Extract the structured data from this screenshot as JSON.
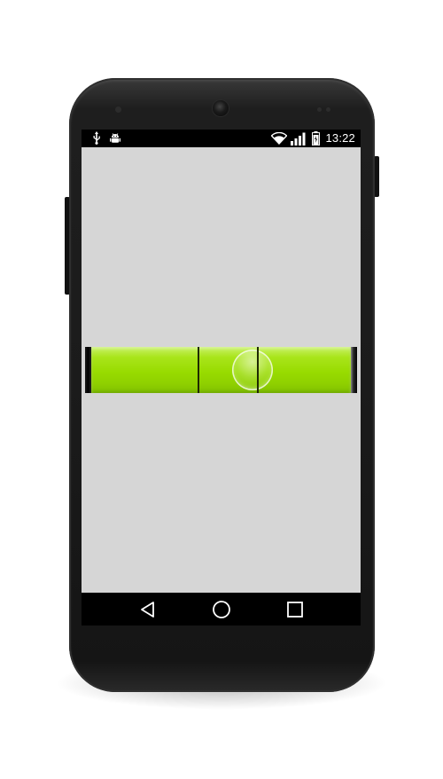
{
  "status_bar": {
    "time": "13:22",
    "icons": [
      "usb-icon",
      "android-debug-icon",
      "wifi-icon",
      "signal-icon",
      "battery-icon"
    ]
  },
  "level_app": {
    "tube_color": "#98db00",
    "bubble_offset_from_center": 0.0
  },
  "nav_bar": {
    "icons": [
      "back-icon",
      "home-icon",
      "recents-icon"
    ]
  },
  "colors": {
    "screen_background": "#d6d6d6",
    "bars": "#000000",
    "phone_body": "#1b1b1b"
  }
}
